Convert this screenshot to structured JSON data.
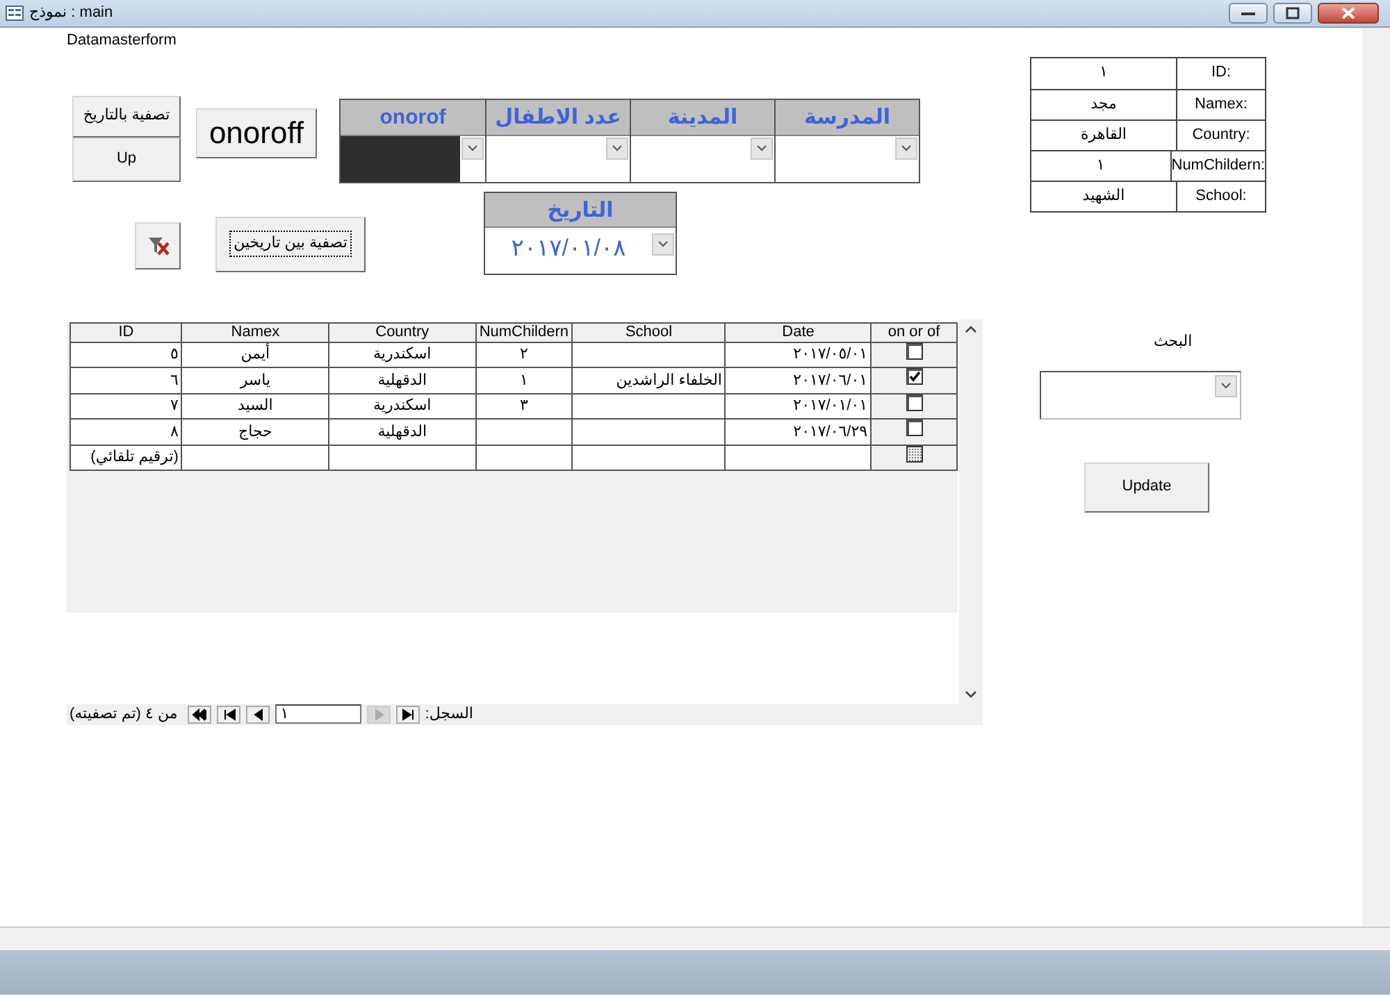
{
  "window": {
    "title": "نموذج : main"
  },
  "form_caption": "Datamasterform",
  "side_buttons": [
    {
      "label": "تصفية بالتاريخ"
    },
    {
      "label": "Up"
    }
  ],
  "toggle_button": {
    "label": "onoroff"
  },
  "filters": [
    {
      "header": "المدرسة",
      "highlighted": false
    },
    {
      "header": "المدينة",
      "highlighted": false
    },
    {
      "header": "عدد الاطفال",
      "highlighted": false
    },
    {
      "header": "onorof",
      "highlighted": true
    }
  ],
  "date_range_button": {
    "label": "تصفية بين تاريخين",
    "focused": true
  },
  "date_filter": {
    "header": "التاريخ",
    "value": "٢٠١٧/٠١/٠٨"
  },
  "record": [
    {
      "label": "ID:",
      "value": "١"
    },
    {
      "label": "Namex:",
      "value": "مجد"
    },
    {
      "label": "Country:",
      "value": "القاهرة"
    },
    {
      "label": "NumChildern:",
      "value": "١"
    },
    {
      "label": "School:",
      "value": "الشهيد"
    }
  ],
  "datasheet": {
    "columns": [
      "on or of",
      "Date",
      "School",
      "NumChildern",
      "Country",
      "Namex",
      "ID"
    ],
    "rows": [
      {
        "cells": [
          {
            "checked": false
          },
          "٢٠١٧/٠٥/٠١",
          null,
          "٢",
          "اسكندرية",
          "أيمن",
          "٥"
        ]
      },
      {
        "cells": [
          {
            "checked": true
          },
          "٢٠١٧/٠٦/٠١",
          "الخلفاء الراشدين",
          "١",
          "الدقهلية",
          "ياسر",
          "٦"
        ]
      },
      {
        "cells": [
          {
            "checked": false
          },
          "٢٠١٧/٠١/٠١",
          null,
          "٣",
          "اسكندرية",
          "السيد",
          "٧"
        ]
      },
      {
        "cells": [
          {
            "checked": false
          },
          "٢٠١٧/٠٦/٢٩",
          null,
          null,
          "الدقهلية",
          "حجاج",
          "٨"
        ]
      }
    ],
    "new_record": {
      "id_placeholder": "(ترقيم تلقائي)"
    }
  },
  "navigation": {
    "label": "السجل:",
    "current": "١",
    "status": "من ٤ (تم تصفيته)",
    "buttons": [
      {
        "kind": "first",
        "disabled": false
      },
      {
        "kind": "previous",
        "disabled": true
      },
      {
        "kind": "next",
        "disabled": false
      },
      {
        "kind": "last",
        "disabled": false
      },
      {
        "kind": "new",
        "disabled": false
      }
    ]
  },
  "search": {
    "label": "البحث"
  },
  "update_button": {
    "label": "Update"
  }
}
